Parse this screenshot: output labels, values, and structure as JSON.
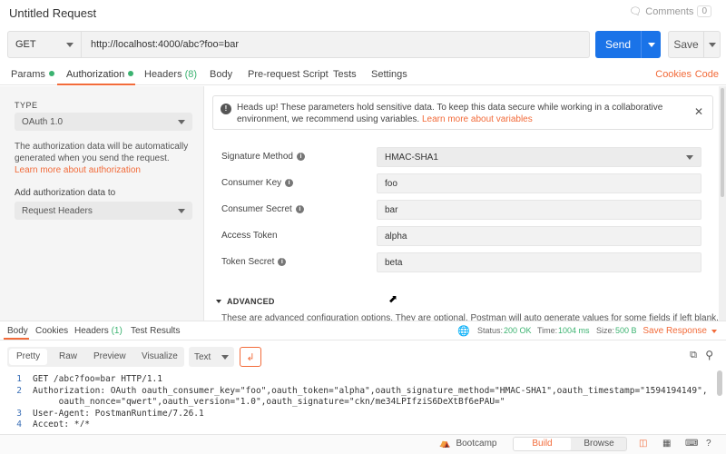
{
  "header": {
    "title": "Untitled Request",
    "comments_label": "Comments",
    "comments_count": "0"
  },
  "request": {
    "method": "GET",
    "url": "http://localhost:4000/abc?foo=bar",
    "send_label": "Send",
    "save_label": "Save"
  },
  "req_tabs": {
    "params": "Params",
    "authorization": "Authorization",
    "headers": "Headers",
    "headers_count": "(8)",
    "body": "Body",
    "prerequest": "Pre-request Script",
    "tests": "Tests",
    "settings": "Settings",
    "cookies": "Cookies",
    "code": "Code"
  },
  "auth": {
    "type_label": "TYPE",
    "type_value": "OAuth 1.0",
    "desc": "The authorization data will be automatically generated when you send the request. ",
    "desc_link": "Learn more about authorization",
    "add_label": "Add authorization data to",
    "add_value": "Request Headers"
  },
  "banner": {
    "text": "Heads up! These parameters hold sensitive data. To keep this data secure while working in a collaborative environment, we recommend using variables. ",
    "link": "Learn more about variables",
    "close": "✕"
  },
  "fields": {
    "sig_label": "Signature Method",
    "sig_value": "HMAC-SHA1",
    "ck_label": "Consumer Key",
    "ck_value": "foo",
    "cs_label": "Consumer Secret",
    "cs_value": "bar",
    "at_label": "Access Token",
    "at_value": "alpha",
    "ts_label": "Token Secret",
    "ts_value": "beta"
  },
  "advanced": {
    "label": "ADVANCED",
    "desc": "These are advanced configuration options. They are optional. Postman will auto generate values for some fields if left blank."
  },
  "resp_tabs": {
    "body": "Body",
    "cookies": "Cookies",
    "headers": "Headers",
    "headers_count": "(1)",
    "test_results": "Test Results"
  },
  "resp_status": {
    "status_label": "Status:",
    "status_value": "200 OK",
    "time_label": "Time:",
    "time_value": "1004 ms",
    "size_label": "Size:",
    "size_value": "500 B",
    "save_response": "Save Response"
  },
  "format": {
    "pretty": "Pretty",
    "raw": "Raw",
    "preview": "Preview",
    "visualize": "Visualize",
    "text": "Text"
  },
  "code_lines": [
    {
      "n": "1",
      "text": "GET /abc?foo=bar HTTP/1.1"
    },
    {
      "n": "2",
      "text": "Authorization: OAuth oauth_consumer_key=\"foo\",oauth_token=\"alpha\",oauth_signature_method=\"HMAC-SHA1\",oauth_timestamp=\"1594194149\","
    },
    {
      "n": "",
      "text": "     oauth_nonce=\"qwert\",oauth_version=\"1.0\",oauth_signature=\"ckn/me34LPIfziS6DeXtBf6ePAU=\""
    },
    {
      "n": "3",
      "text": "User-Agent: PostmanRuntime/7.26.1"
    },
    {
      "n": "4",
      "text": "Accept: */*"
    }
  ],
  "status_bar": {
    "bootcamp": "Bootcamp",
    "build": "Build",
    "browse": "Browse"
  },
  "colors": {
    "accent": "#f26b3a",
    "primary": "#1a73e8",
    "success": "#3cb371"
  }
}
